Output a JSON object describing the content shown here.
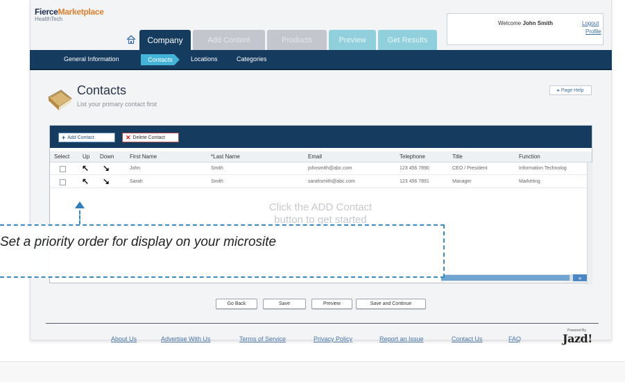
{
  "logo": {
    "line1_main": "Fierce",
    "line1_accent": "Marketplace",
    "line2": "HealthTech"
  },
  "header": {
    "welcome_prefix": "Welcome",
    "user_name": "John Smith",
    "logout": "Logout",
    "profile": "Profile"
  },
  "tabs": [
    {
      "label": "Company"
    },
    {
      "label": "Add Content"
    },
    {
      "label": "Products"
    },
    {
      "label": "Preview"
    },
    {
      "label": "Get Results"
    }
  ],
  "subnav": [
    "General Information",
    "Contacts",
    "Locations",
    "Categories"
  ],
  "page": {
    "title": "Contacts",
    "subtitle": "List your primary contact first",
    "page_help": "▸ Page Help"
  },
  "toolbar": {
    "add_label": "Add Contact",
    "delete_label": "Delete Contact"
  },
  "grid": {
    "columns": [
      "Select",
      "Up",
      "Down",
      "First Name",
      "*Last Name",
      "Email",
      "Telephone",
      "Title",
      "Function"
    ],
    "rows": [
      {
        "first": "John",
        "last": "Smith",
        "email": "johnsmith@abc.com",
        "phone": "123 456 7890",
        "title": "CEO / President",
        "function": "Information Technolog"
      },
      {
        "first": "Sarah",
        "last": "Smith",
        "email": "sarahsmith@abc.com",
        "phone": "123 456 7891",
        "title": "Manager",
        "function": "Marketing"
      }
    ],
    "empty_line1": "Click the ADD Contact",
    "empty_line2": "button to get started"
  },
  "buttons": {
    "back": "Go Back",
    "save": "Save",
    "preview": "Preview",
    "save_continue": "Save and Continue"
  },
  "footer": {
    "links": [
      "About Us",
      "Advertise With Us",
      "Terms of Service",
      "Privacy Policy",
      "Report an Issue",
      "Contact Us",
      "FAQ"
    ],
    "powered_by": "Powered By",
    "brand": "Jazd!"
  },
  "callout": {
    "text": "Set a priority order for display on your microsite"
  },
  "colors": {
    "navy": "#153b5f",
    "accent_blue": "#44b3d8",
    "callout_border": "#3a8ac2"
  }
}
